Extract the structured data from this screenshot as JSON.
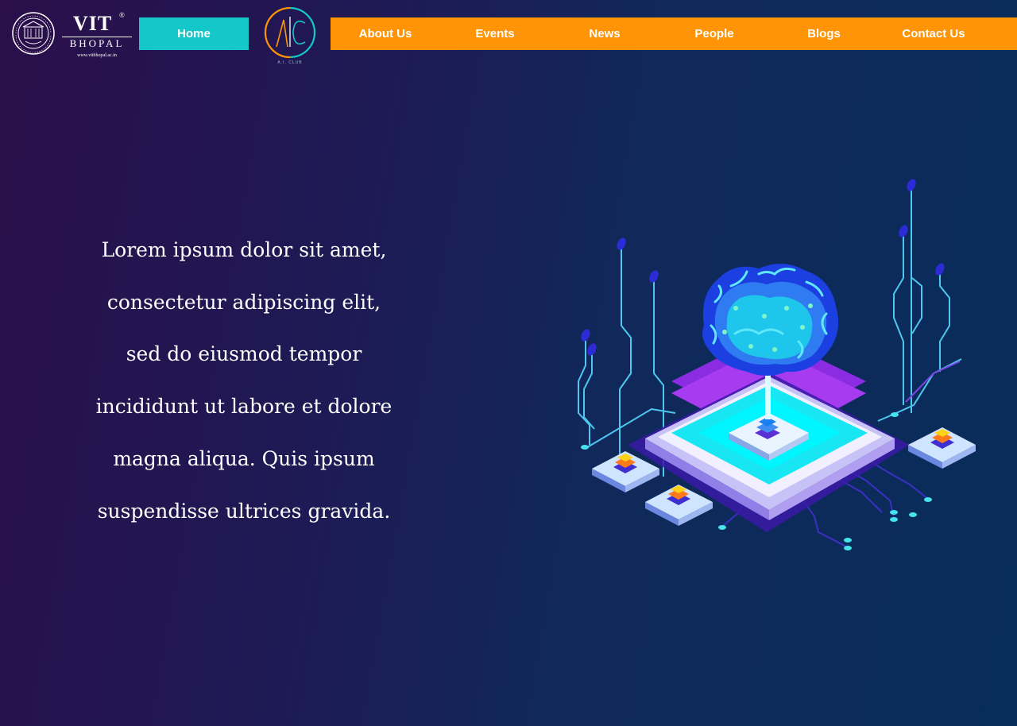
{
  "header": {
    "college_logo": {
      "name": "VIT",
      "registered_mark": "®",
      "city": "BHOPAL",
      "website": "www.vitbhopal.ac.in"
    },
    "home_button_label": "Home",
    "club_logo": {
      "monogram": "AIC",
      "caption": "A.I. CLUB"
    },
    "nav_items": [
      {
        "label": "About Us"
      },
      {
        "label": "Events"
      },
      {
        "label": "News"
      },
      {
        "label": "People"
      },
      {
        "label": "Blogs"
      },
      {
        "label": "Contact Us"
      }
    ]
  },
  "hero": {
    "lines": [
      "Lorem ipsum dolor sit amet,",
      "consectetur adipiscing elit,",
      "sed do eiusmod tempor",
      "incididunt ut labore et dolore",
      "magna aliqua. Quis ipsum",
      "suspendisse ultrices gravida."
    ],
    "illustration_icon": "ai-brain-chip-icon"
  },
  "colors": {
    "nav_background": "#ff9407",
    "home_button": "#14c7c9",
    "background_left": "#2a0f4a",
    "background_right": "#082d5a",
    "text": "#ffffff"
  }
}
